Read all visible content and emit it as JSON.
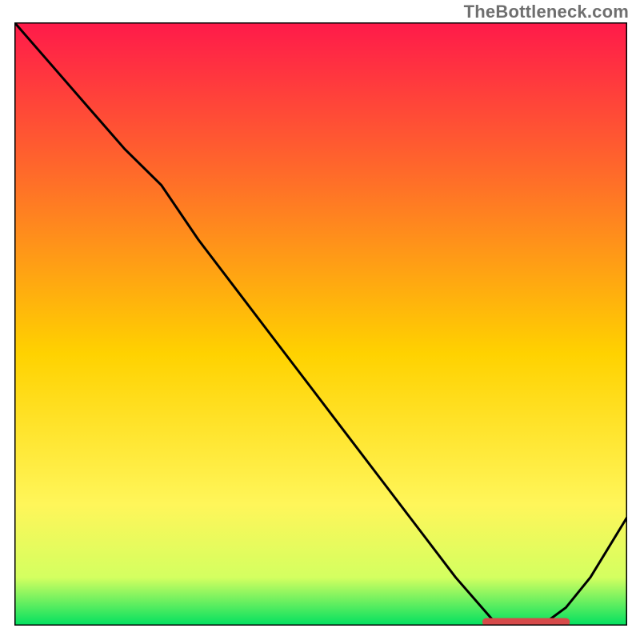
{
  "watermark": "TheBottleneck.com",
  "chart_data": {
    "type": "line",
    "title": "",
    "xlabel": "",
    "ylabel": "",
    "xlim": [
      0,
      100
    ],
    "ylim": [
      0,
      100
    ],
    "grid": false,
    "legend": false,
    "gradient_stops": [
      {
        "offset": 0.0,
        "color": "#ff1a4a"
      },
      {
        "offset": 0.25,
        "color": "#ff6a2a"
      },
      {
        "offset": 0.55,
        "color": "#ffd200"
      },
      {
        "offset": 0.8,
        "color": "#fff65a"
      },
      {
        "offset": 0.92,
        "color": "#d4ff60"
      },
      {
        "offset": 1.0,
        "color": "#00e060"
      }
    ],
    "series": [
      {
        "name": "curve",
        "x": [
          0,
          6,
          12,
          18,
          24,
          30,
          36,
          42,
          48,
          54,
          60,
          66,
          72,
          78,
          82,
          86,
          90,
          94,
          100
        ],
        "values": [
          100,
          93,
          86,
          79,
          73,
          64,
          56,
          48,
          40,
          32,
          24,
          16,
          8,
          1,
          0,
          0,
          3,
          8,
          18
        ]
      }
    ],
    "marker": {
      "name": "highlight-segment",
      "x_start": 77,
      "x_end": 90,
      "y": 0.6,
      "color": "#d64a4a",
      "thickness": 1.3
    }
  }
}
